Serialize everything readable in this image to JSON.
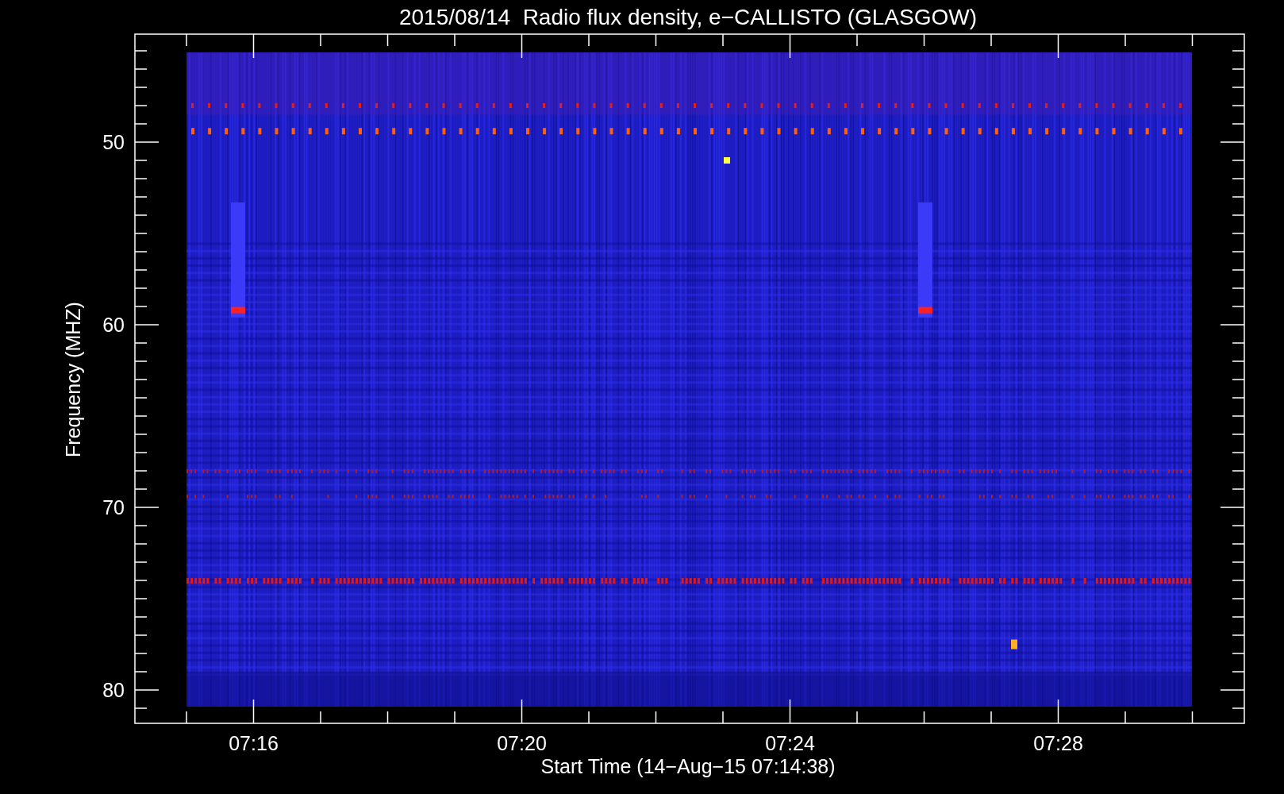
{
  "title": "2015/08/14  Radio flux density, e−CALLISTO (GLASGOW)",
  "y_axis": {
    "label": "Frequency (MHZ)",
    "ticks": [
      "50",
      "60",
      "70",
      "80"
    ]
  },
  "x_axis": {
    "label": "Start Time (14−Aug−15 07:14:38)",
    "ticks": [
      "07:16",
      "07:20",
      "07:24",
      "07:28"
    ]
  }
}
